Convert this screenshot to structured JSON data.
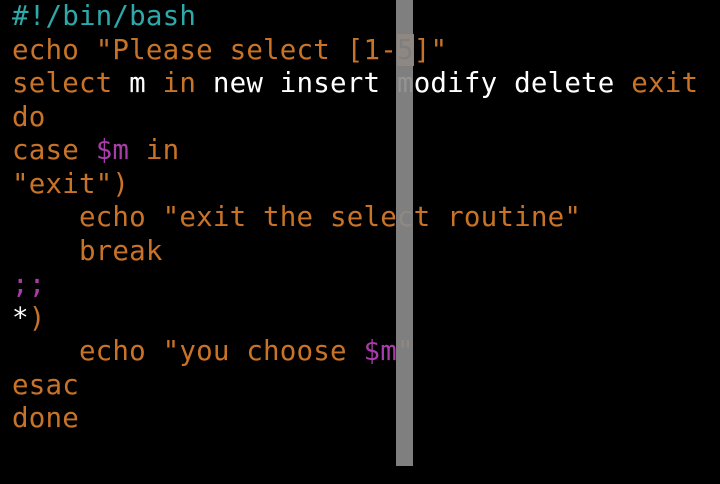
{
  "colors": {
    "background": "#000000",
    "comment": "#2ea8a8",
    "keyword": "#c87328",
    "string": "#c87328",
    "variable": "#a83ca8",
    "plain": "#ffffff",
    "scrollbar": "#8a8a8a"
  },
  "editor": {
    "lines": [
      {
        "segments": [
          {
            "text": "#!/bin/bash",
            "type": "comment"
          }
        ]
      },
      {
        "segments": [
          {
            "text": "echo ",
            "type": "keyword"
          },
          {
            "text": "\"Please select [1-",
            "type": "string"
          },
          {
            "text": "5",
            "type": "cursor"
          },
          {
            "text": "]\"",
            "type": "string"
          }
        ]
      },
      {
        "segments": [
          {
            "text": "select",
            "type": "keyword"
          },
          {
            "text": " m ",
            "type": "plain"
          },
          {
            "text": "in",
            "type": "keyword"
          },
          {
            "text": " new insert modify delete ",
            "type": "plain"
          },
          {
            "text": "exit",
            "type": "keyword"
          }
        ]
      },
      {
        "segments": [
          {
            "text": "do",
            "type": "keyword"
          }
        ]
      },
      {
        "segments": [
          {
            "text": "case ",
            "type": "keyword"
          },
          {
            "text": "$m",
            "type": "variable"
          },
          {
            "text": " in",
            "type": "keyword"
          }
        ]
      },
      {
        "segments": [
          {
            "text": "\"exit\"",
            "type": "string"
          },
          {
            "text": ")",
            "type": "keyword"
          }
        ]
      },
      {
        "segments": [
          {
            "text": "    echo ",
            "type": "keyword"
          },
          {
            "text": "\"exit the select routine\"",
            "type": "string"
          }
        ]
      },
      {
        "segments": [
          {
            "text": "    break",
            "type": "keyword"
          }
        ]
      },
      {
        "segments": [
          {
            "text": ";;",
            "type": "variable"
          }
        ]
      },
      {
        "segments": [
          {
            "text": "*",
            "type": "plain"
          },
          {
            "text": ")",
            "type": "keyword"
          }
        ]
      },
      {
        "segments": [
          {
            "text": "    echo ",
            "type": "keyword"
          },
          {
            "text": "\"you choose ",
            "type": "string"
          },
          {
            "text": "$m",
            "type": "variable"
          },
          {
            "text": "\"",
            "type": "string"
          }
        ]
      },
      {
        "segments": [
          {
            "text": "esac",
            "type": "keyword"
          }
        ]
      },
      {
        "segments": [
          {
            "text": "done",
            "type": "keyword"
          }
        ]
      }
    ]
  }
}
